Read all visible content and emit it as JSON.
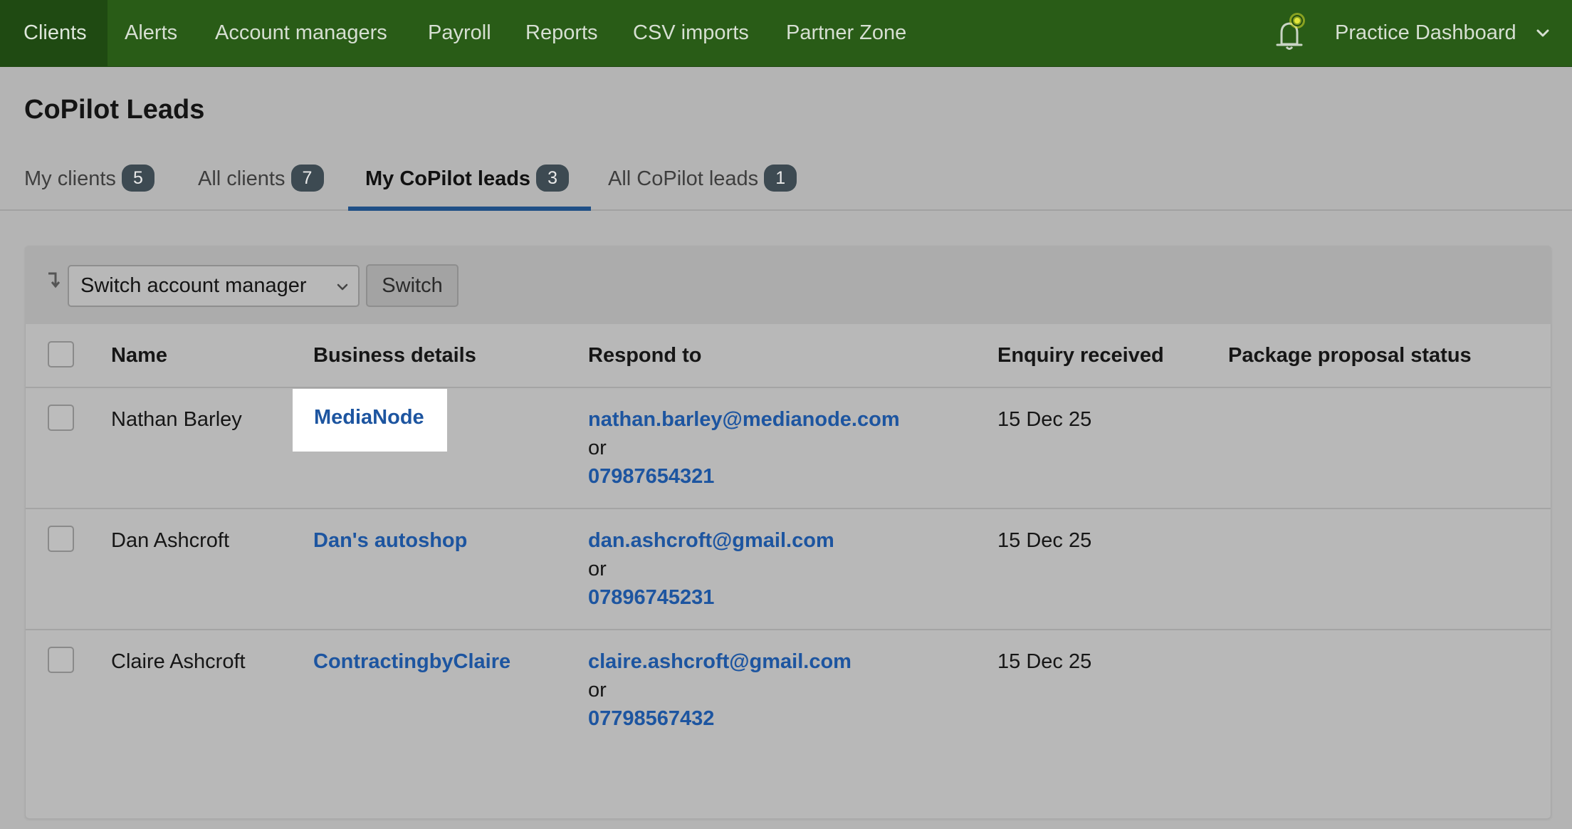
{
  "nav": {
    "items": [
      "Clients",
      "Alerts",
      "Account managers",
      "Payroll",
      "Reports",
      "CSV imports",
      "Partner Zone"
    ],
    "active": "Clients",
    "right_label": "Practice Dashboard",
    "icons": [
      "bell-icon",
      "chevron-down-icon"
    ]
  },
  "page": {
    "title": "CoPilot Leads"
  },
  "tabs": [
    {
      "label": "My clients",
      "count": "5"
    },
    {
      "label": "All clients",
      "count": "7"
    },
    {
      "label": "My CoPilot leads",
      "count": "3"
    },
    {
      "label": "All CoPilot leads",
      "count": "1"
    }
  ],
  "toolbar": {
    "select_value": "Switch account manager",
    "switch_label": "Switch"
  },
  "table": {
    "headers": [
      "Name",
      "Business details",
      "Respond to",
      "Enquiry received",
      "Package proposal status"
    ],
    "rows": [
      {
        "name": "Nathan Barley",
        "business": "MediaNode",
        "email": "nathan.barley@medianode.com",
        "or": "or",
        "phone": "07987654321",
        "received": "15 Dec 25",
        "status": ""
      },
      {
        "name": "Dan Ashcroft",
        "business": "Dan's autoshop",
        "email": "dan.ashcroft@gmail.com",
        "or": "or",
        "phone": "07896745231",
        "received": "15 Dec 25",
        "status": ""
      },
      {
        "name": "Claire Ashcroft",
        "business": "ContractingbyClaire",
        "email": "claire.ashcroft@gmail.com",
        "or": "or",
        "phone": "07798567432",
        "received": "15 Dec 25",
        "status": ""
      }
    ]
  },
  "colors": {
    "nav_bg": "#295c17",
    "link": "#1d55a0",
    "tab_underline": "#1f4f86",
    "badge": "#3d4a52",
    "overlay_bg": "#b4b4b4"
  }
}
